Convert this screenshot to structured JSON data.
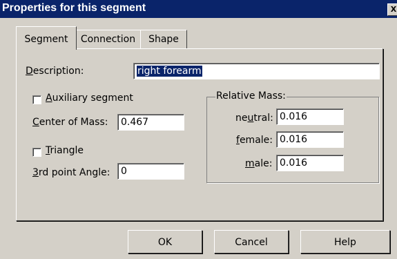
{
  "window": {
    "title": "Properties for this segment",
    "close_glyph": "X"
  },
  "tabs": [
    {
      "label": "Segment",
      "active": true
    },
    {
      "label": "Connection",
      "active": false
    },
    {
      "label": "Shape",
      "active": false
    }
  ],
  "segment": {
    "description_label_pre": "",
    "description_label_access": "D",
    "description_label_post": "escription:",
    "description_value": "right forearm",
    "auxiliary_label_pre": "",
    "auxiliary_label_access": "A",
    "auxiliary_label_post": "uxiliary segment",
    "auxiliary_checked": false,
    "com_label_pre": "",
    "com_label_access": "C",
    "com_label_post": "enter of Mass:",
    "com_value": "0.467",
    "triangle_label_pre": "",
    "triangle_label_access": "T",
    "triangle_label_post": "riangle",
    "triangle_checked": false,
    "angle_label_pre": "",
    "angle_label_access": "3",
    "angle_label_post": "rd point Angle:",
    "angle_value": "0"
  },
  "relative_mass": {
    "legend": "Relative Mass:",
    "neutral_pre": "ne",
    "neutral_access": "u",
    "neutral_post": "tral:",
    "neutral_value": "0.016",
    "female_pre": "",
    "female_access": "f",
    "female_post": "emale:",
    "female_value": "0.016",
    "male_pre": "",
    "male_access": "m",
    "male_post": "ale:",
    "male_value": "0.016"
  },
  "buttons": {
    "ok": "OK",
    "cancel": "Cancel",
    "help": "Help"
  },
  "colors": {
    "titlebar": "#0a246a",
    "face": "#d4d0c8",
    "selection": "#0a246a"
  }
}
